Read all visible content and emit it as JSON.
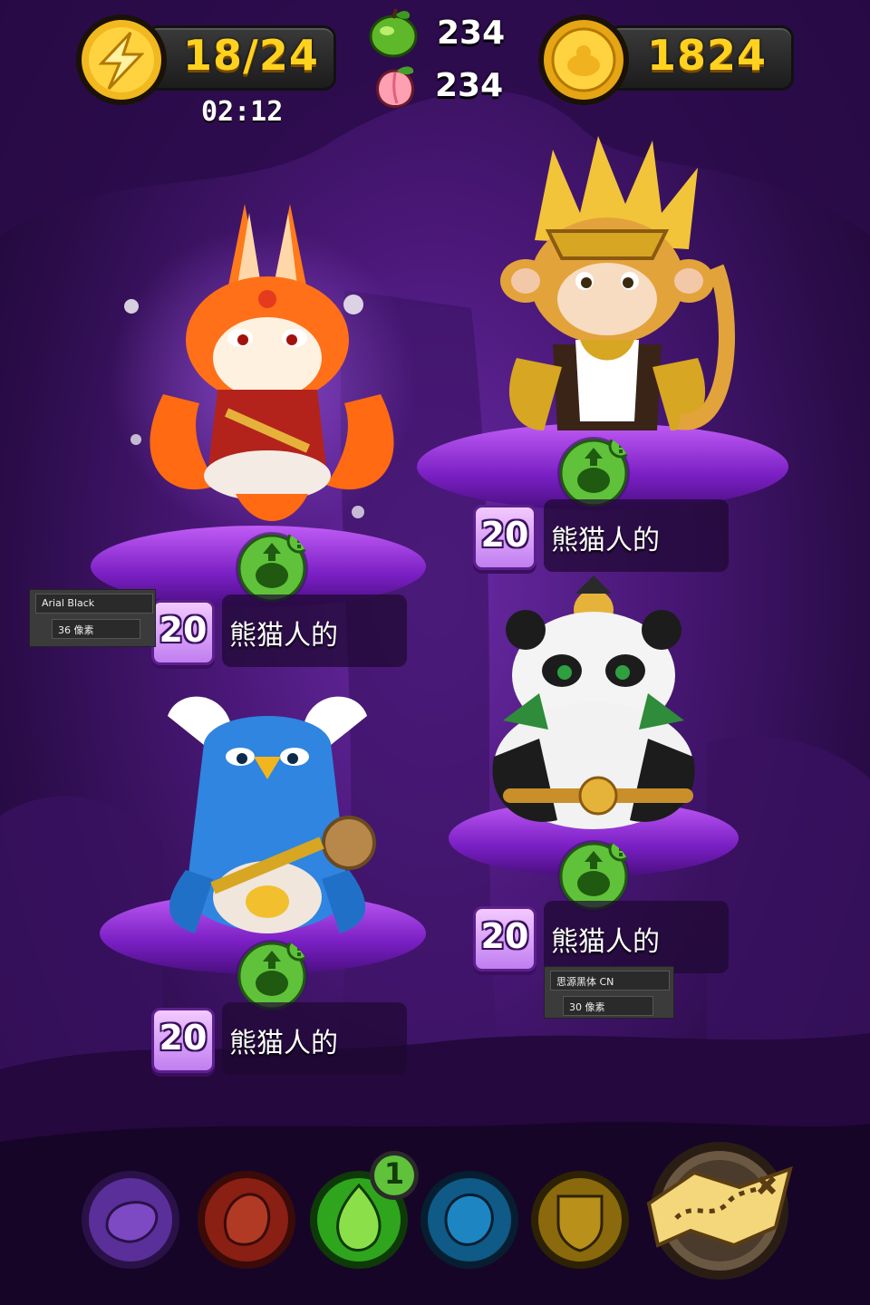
{
  "hud": {
    "energy": {
      "value": "18/24",
      "timer": "02:12",
      "icon": "lightning-energy-icon"
    },
    "resources": [
      {
        "icon": "green-apple-icon",
        "value": "234"
      },
      {
        "icon": "peach-icon",
        "value": "234"
      }
    ],
    "gold": {
      "value": "1824",
      "icon": "gold-coin-icon"
    }
  },
  "characters": [
    {
      "name": "熊猫人的",
      "level": "20",
      "creature": "fox-warrior",
      "alert": "!"
    },
    {
      "name": "熊猫人的",
      "level": "20",
      "creature": "golden-monkey",
      "alert": "!"
    },
    {
      "name": "熊猫人的",
      "level": "20",
      "creature": "panda-monk",
      "alert": "!"
    },
    {
      "name": "熊猫人的",
      "level": "20",
      "creature": "blue-penguin",
      "alert": "!"
    }
  ],
  "ps_overlays": [
    {
      "font": "Arial Black",
      "size": "36 像素"
    },
    {
      "font": "思源黑体 CN",
      "size": "30 像素"
    }
  ],
  "bottom_bar": {
    "elements": [
      {
        "name": "purple-element-button",
        "color": "#5a2f9a",
        "active": false
      },
      {
        "name": "red-element-button",
        "color": "#8a1f14",
        "active": false
      },
      {
        "name": "green-element-button",
        "color": "#2fa51e",
        "active": true,
        "badge": "1"
      },
      {
        "name": "blue-element-button",
        "color": "#0f5a86",
        "active": false
      },
      {
        "name": "yellow-element-button",
        "color": "#8a6a0c",
        "active": false
      }
    ],
    "map_icon": "treasure-map-icon"
  },
  "colors": {
    "gold_text": "#ffd21f",
    "card_badge": "#c07ef0",
    "upgrade_green": "#5fc23a"
  }
}
